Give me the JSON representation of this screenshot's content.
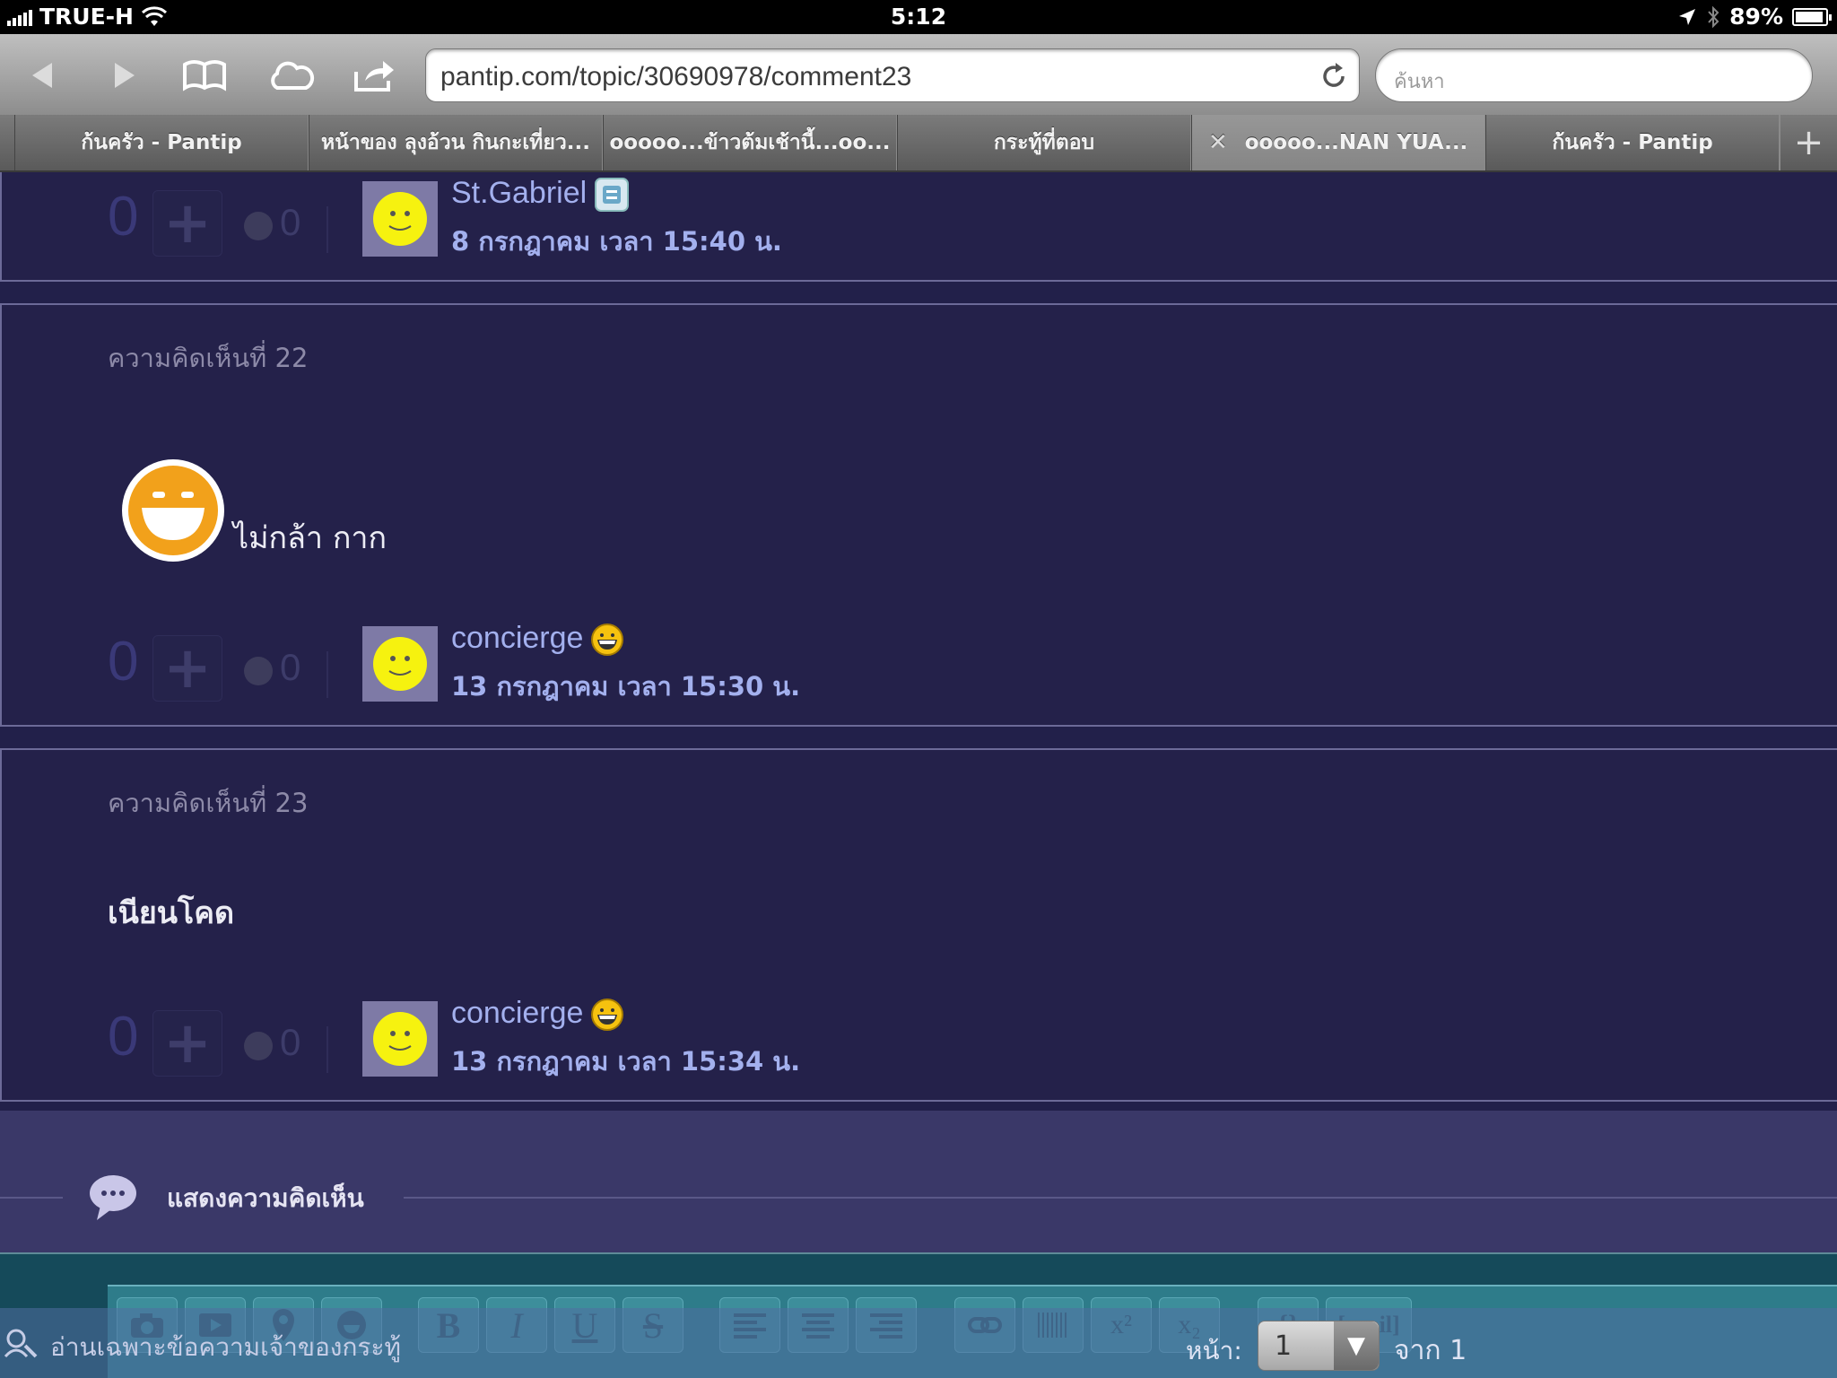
{
  "status_bar": {
    "carrier": "TRUE-H",
    "time": "5:12",
    "battery": "89%",
    "battery_level": 0.89
  },
  "toolbar": {
    "url": "pantip.com/topic/30690978/comment23",
    "search_placeholder": "ค้นหา"
  },
  "tabs": [
    {
      "label": "ก้นครัว - Pantip",
      "active": false
    },
    {
      "label": "หน้าของ ลุงอ้วน กินกะเที่ยว...",
      "active": false
    },
    {
      "label": "ooooo...ข้าวต้มเช้านี้...oo...",
      "active": false
    },
    {
      "label": "กระทู้ที่ตอบ",
      "active": false
    },
    {
      "label": "ooooo...NAN YUA...",
      "active": true
    },
    {
      "label": "ก้นครัว - Pantip",
      "active": false
    }
  ],
  "comments": [
    {
      "votes": "0",
      "emotions": "0",
      "username": "St.Gabriel",
      "timestamp": "8 กรกฎาคม เวลา 15:40 น."
    },
    {
      "label": "ความคิดเห็นที่ 22",
      "body": "ไม่กล้า กาก",
      "votes": "0",
      "emotions": "0",
      "username": "concierge",
      "timestamp": "13 กรกฎาคม เวลา 15:30 น."
    },
    {
      "label": "ความคิดเห็นที่ 23",
      "body": "เนียนโคด",
      "votes": "0",
      "emotions": "0",
      "username": "concierge",
      "timestamp": "13 กรกฎาคม เวลา 15:34 น."
    }
  ],
  "add_comment": {
    "title": "แสดงความคิดเห็น"
  },
  "editor": {
    "bold": "B",
    "italic": "I",
    "underline": "U",
    "strike": "S",
    "superscript": "x²",
    "subscript": "x₂",
    "code": "{}",
    "spoil": "[spoil]"
  },
  "bottom_bar": {
    "filter_text": "อ่านเฉพาะข้อความเจ้าของกระทู้",
    "page_label": "หน้า:",
    "page_value": "1",
    "page_of": "จาก 1"
  }
}
